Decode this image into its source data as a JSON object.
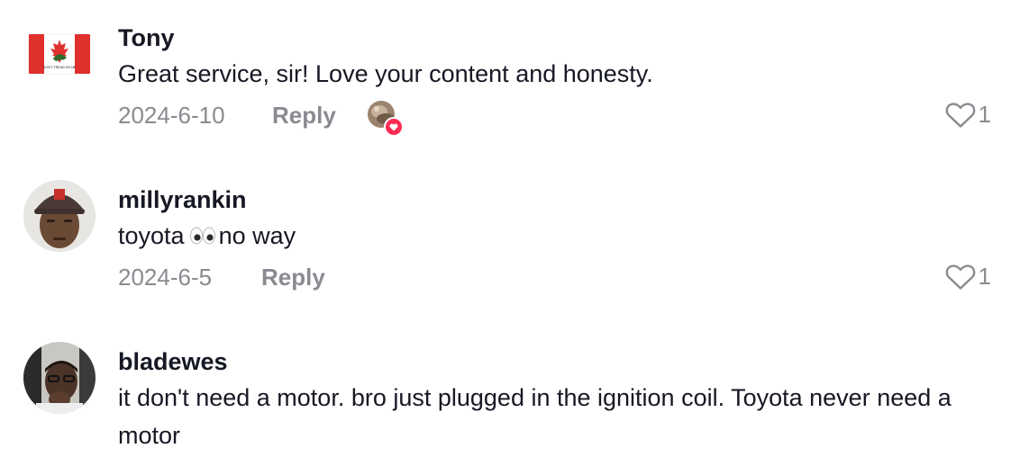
{
  "comments": [
    {
      "username": "Tony",
      "text": "Great service, sir! Love your content and honesty.",
      "date": "2024-6-10",
      "reply_label": "Reply",
      "likes": "1",
      "flag_text": "DON'T TREAD ON ME"
    },
    {
      "username": "millyrankin",
      "text_before": "toyota",
      "text_after": "no way",
      "date": "2024-6-5",
      "reply_label": "Reply",
      "likes": "1"
    },
    {
      "username": "bladewes",
      "text": "it don't need a motor. bro just plugged in the ignition coil. Toyota never need a motor"
    }
  ],
  "icons": {
    "like": "heart-outline-icon",
    "eyes": "eyes-emoji-icon",
    "creator_liked": "heart-badge-icon"
  },
  "colors": {
    "text": "#161823",
    "secondary": "#8a8b91",
    "heart_badge": "#fe2c55",
    "flag_red": "#e0302e"
  }
}
